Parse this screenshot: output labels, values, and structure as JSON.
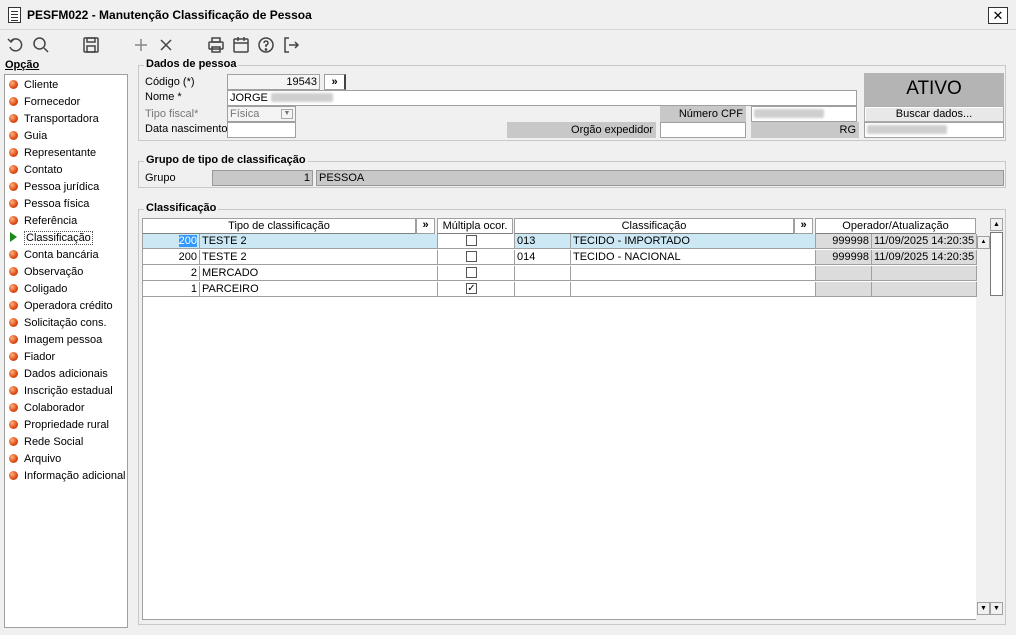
{
  "window": {
    "title": "PESFM022 - Manutenção Classificação de Pessoa",
    "close_label": "✕"
  },
  "toolbar": {
    "icons": [
      "undo-icon",
      "search-icon",
      "save-icon",
      "add-icon",
      "delete-icon",
      "print-icon",
      "calendar-icon",
      "help-icon",
      "exit-icon"
    ]
  },
  "sidebar": {
    "header": "Opção",
    "items": [
      {
        "label": "Cliente"
      },
      {
        "label": "Fornecedor"
      },
      {
        "label": "Transportadora"
      },
      {
        "label": "Guia"
      },
      {
        "label": "Representante"
      },
      {
        "label": "Contato"
      },
      {
        "label": "Pessoa jurídica"
      },
      {
        "label": "Pessoa física"
      },
      {
        "label": "Referência"
      },
      {
        "label": "Classificação"
      },
      {
        "label": "Conta bancária"
      },
      {
        "label": "Observação"
      },
      {
        "label": "Coligado"
      },
      {
        "label": "Operadora crédito"
      },
      {
        "label": "Solicitação cons."
      },
      {
        "label": "Imagem pessoa"
      },
      {
        "label": "Fiador"
      },
      {
        "label": "Dados adicionais"
      },
      {
        "label": "Inscrição estadual"
      },
      {
        "label": "Colaborador"
      },
      {
        "label": "Propriedade rural"
      },
      {
        "label": "Rede Social"
      },
      {
        "label": "Arquivo"
      },
      {
        "label": "Informação adicional"
      }
    ],
    "active_index": 9
  },
  "dados": {
    "legend": "Dados de pessoa",
    "codigo_label": "Código (*)",
    "codigo_value": "19543",
    "expand": "»",
    "nome_label": "Nome *",
    "nome_value": "JORGE",
    "tipo_fiscal_label": "Tipo fiscal*",
    "tipo_fiscal_value": "Física",
    "data_nasc_label": "Data nascimento",
    "numero_cpf_label": "Número CPF",
    "orgao_label": "Orgão expedidor",
    "rg_label": "RG",
    "status": "ATIVO",
    "buscar_label": "Buscar dados..."
  },
  "grupo": {
    "legend": "Grupo de tipo de classificação",
    "label": "Grupo",
    "code": "1",
    "name": "PESSOA"
  },
  "classificacao": {
    "legend": "Classificação",
    "headers": {
      "tipo": "Tipo de classificação",
      "multipla": "Múltipla ocor.",
      "classificacao": "Classificação",
      "operador": "Operador/Atualização",
      "expand": "»"
    },
    "rows": [
      {
        "code": "200",
        "tipo": "TESTE 2",
        "multipla": false,
        "cls_code": "013",
        "cls_name": "TECIDO - IMPORTADO",
        "operador": "999998",
        "data": "11/09/2025 14:20:35"
      },
      {
        "code": "200",
        "tipo": "TESTE 2",
        "multipla": false,
        "cls_code": "014",
        "cls_name": "TECIDO - NACIONAL",
        "operador": "999998",
        "data": "11/09/2025 14:20:35"
      },
      {
        "code": "2",
        "tipo": "MERCADO",
        "multipla": false,
        "cls_code": "",
        "cls_name": "",
        "operador": "",
        "data": ""
      },
      {
        "code": "1",
        "tipo": "PARCEIRO",
        "multipla": true,
        "cls_code": "",
        "cls_name": "",
        "operador": "",
        "data": ""
      }
    ]
  }
}
